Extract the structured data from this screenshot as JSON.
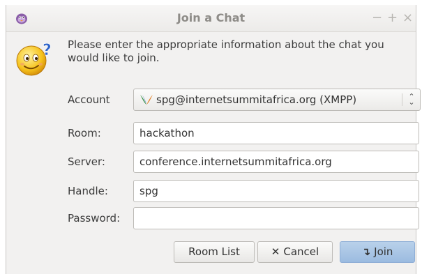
{
  "window": {
    "title": "Join a Chat",
    "controls": {
      "minimize": "−",
      "maximize": "+",
      "close": "×"
    }
  },
  "intro_text": "Please enter the appropriate information about the chat you would like to join.",
  "form": {
    "account_label": "Account",
    "account_value": "spg@internetsummitafrica.org (XMPP)",
    "room_label": "Room:",
    "room_value": "hackathon",
    "server_label": "Server:",
    "server_value": "conference.internetsummitafrica.org",
    "handle_label": "Handle:",
    "handle_value": "spg",
    "password_label": "Password:",
    "password_value": ""
  },
  "buttons": {
    "room_list": "Room List",
    "cancel": "Cancel",
    "cancel_icon": "✕",
    "join": "Join",
    "join_icon": "↴"
  },
  "icons": {
    "app": "pidgin-icon",
    "emoticon": "confused-smiley-icon",
    "account": "xmpp-icon"
  },
  "colors": {
    "join_button": "#a9c6e6",
    "title_text": "#8e8c88"
  }
}
